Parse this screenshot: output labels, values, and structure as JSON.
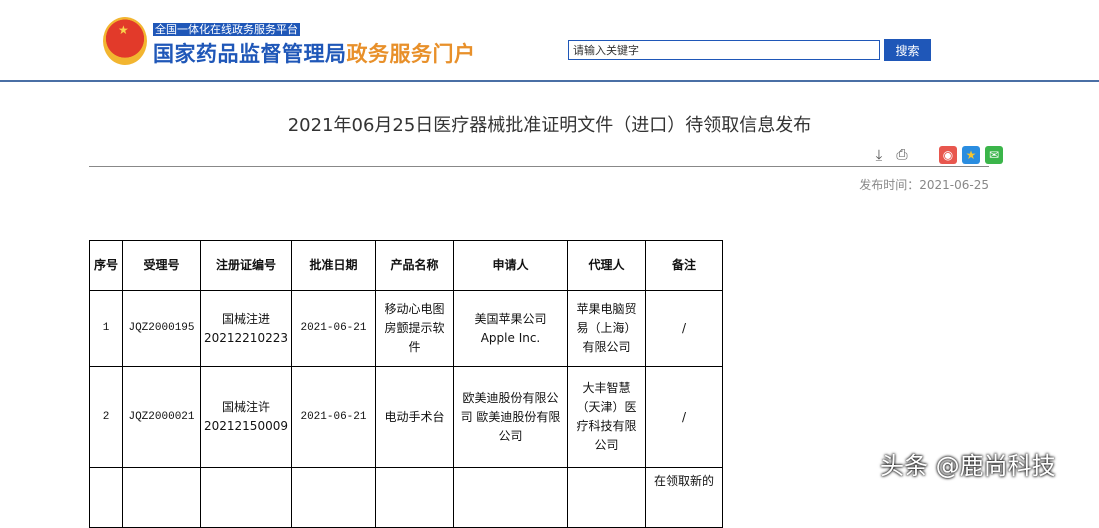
{
  "header": {
    "tagline": "全国一体化在线政务服务平台",
    "site_name_main": "国家药品监督管理局",
    "site_name_accent": "政务服务门户",
    "search_value": "请输入关键字",
    "search_button": "搜索"
  },
  "article": {
    "title": "2021年06月25日医疗器械批准证明文件（进口）待领取信息发布",
    "publish_date": "发布时间：2021-06-25"
  },
  "table": {
    "headers": [
      "序号",
      "受理号",
      "注册证编号",
      "批准日期",
      "产品名称",
      "申请人",
      "代理人",
      "备注"
    ],
    "rows": [
      [
        "1",
        "JQZ2000195",
        "国械注进 20212210223",
        "2021-06-21",
        "移动心电图房颤提示软件",
        "美国苹果公司 Apple Inc.",
        "苹果电脑贸易（上海）有限公司",
        "/"
      ],
      [
        "2",
        "JQZ2000021",
        "国械注许 20212150009",
        "2021-06-21",
        "电动手术台",
        "欧美迪股份有限公司 歐美迪股份有限公司",
        "大丰智慧（天津）医疗科技有限公司",
        "/"
      ],
      [
        "",
        "",
        "",
        "",
        "",
        "",
        "",
        "在领取新的"
      ]
    ]
  },
  "watermark": "头条 @鹿尚科技"
}
